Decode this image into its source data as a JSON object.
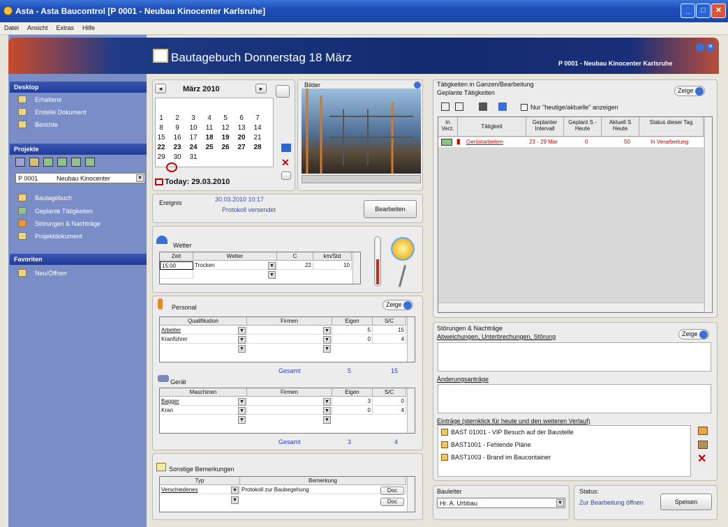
{
  "window": {
    "title": "Asta - Asta Baucontrol [P 0001 - Neubau Kinocenter Karlsruhe]"
  },
  "menu": [
    "Datei",
    "Ansicht",
    "Extras",
    "Hilfe"
  ],
  "banner": {
    "title": "Bautagebuch  Donnerstag 18 März",
    "project": "P 0001 - Neubau Kinocenter Karlsruhe"
  },
  "sidebar": {
    "desktop_header": "Desktop",
    "desktop_items": [
      "Erhaltene",
      "Erstelle Dokument",
      "Berichte"
    ],
    "project_header": "Projekte",
    "project_id": "P 0001",
    "project_name": "Neubau Kinocenter",
    "project_items": [
      "Bautagebuch",
      "Geplante Tätigkeiten",
      "Störungen & Nachträge",
      "Projektdokument"
    ],
    "favorites_header": "Favoriten",
    "favorites_items": [
      "Neu/Öffnen"
    ]
  },
  "calendar": {
    "month": "März 2010",
    "rows": [
      [
        "1",
        "2",
        "3",
        "4",
        "5",
        "6",
        "7"
      ],
      [
        "8",
        "9",
        "10",
        "11",
        "12",
        "13",
        "14"
      ],
      [
        "15",
        "16",
        "17",
        "18",
        "19",
        "20",
        "21"
      ],
      [
        "22",
        "23",
        "24",
        "25",
        "26",
        "27",
        "28"
      ],
      [
        "29",
        "30",
        "31",
        "",
        "",
        "",
        ""
      ]
    ],
    "today": "Today: 29.03.2010"
  },
  "photos": {
    "label": "Bilder"
  },
  "ereignis": {
    "label": "Ereignis",
    "timestamp": "30.03.2010 10:17",
    "status": "Protokoll versendet",
    "button": "Bearbeiten"
  },
  "weather": {
    "label": "Wetter",
    "headers": [
      "Zeit",
      "Wetter",
      "C",
      "km/Std"
    ],
    "row": {
      "zeit": "15:00",
      "wetter": "Trocken",
      "c": "22",
      "kmh": "10"
    }
  },
  "personal": {
    "label": "Personal",
    "zeige": "Zeige",
    "headers": [
      "Qualifikation",
      "Firmen",
      "Eigen",
      "S/C"
    ],
    "rows": [
      {
        "q": "Arbeiter",
        "eigen": "5",
        "sc": "15"
      },
      {
        "q": "Kranführer",
        "eigen": "0",
        "sc": "4"
      }
    ],
    "total_label": "Gesamt",
    "total_eigen": "5",
    "total_sc": "15"
  },
  "geraet": {
    "label": "Gerät",
    "headers": [
      "Maschinen",
      "Firmen",
      "Eigen",
      "S/C"
    ],
    "rows": [
      {
        "m": "Bagger",
        "eigen": "3",
        "sc": "0"
      },
      {
        "m": "Kran",
        "eigen": "0",
        "sc": "4"
      }
    ],
    "total_label": "Gesamt",
    "total_eigen": "3",
    "total_sc": "4"
  },
  "sonstige": {
    "label": "Sonstige Bemerkungen",
    "headers": [
      "Typ",
      "Bemerkung"
    ],
    "row": {
      "typ": "Verschiedenes",
      "bem": "Protokoll zur Baubegehung"
    },
    "doc": "Doc"
  },
  "activities": {
    "title": "Tätigkeiten in Ganzen/Bearbeitung",
    "subtitle": "Geplante Tätigkeiten",
    "zeige": "Zeige",
    "checkbox": "Nur \"heutige/aktuelle\" anzeigen",
    "headers": [
      "In Verz.",
      "Tätigkeit",
      "Geplanter Intervall",
      "Geplant S - Heute",
      "Aktuell S Heute",
      "Status dieser Tag"
    ],
    "row": {
      "name": "Gerüstarbeiten",
      "interval": "23 - 29 Mar",
      "geplant": "0",
      "aktuell": "50",
      "status": "In Verarbeitung"
    }
  },
  "stoerungen": {
    "title": "Störungen & Nachträge",
    "subtitle": "Abweichungen, Unterbrechungen, Störung",
    "zeige": "Zeige",
    "aenderung": "Änderungsanträge",
    "eintraege": "Einträge (sternklick für heute und den weiteren Verlauf)",
    "items": [
      "BAST 01001 - VIP Besuch auf der Baustelle",
      "BAST1001 - Fehlende Pläne",
      "BAST1003 - Brand im Baucontainer"
    ]
  },
  "bauleiter": {
    "label": "Bauleiter",
    "value": "Hr. A. Urbbau"
  },
  "status": {
    "label": "Status:",
    "value": "Zur Bearbeitung öffnen",
    "save": "Speisen"
  },
  "colors": {
    "title_bar": "#1d4fb8",
    "sidebar": "#7b8dc6",
    "header_blue": "#2a3fb0",
    "red": "#cc0000"
  }
}
